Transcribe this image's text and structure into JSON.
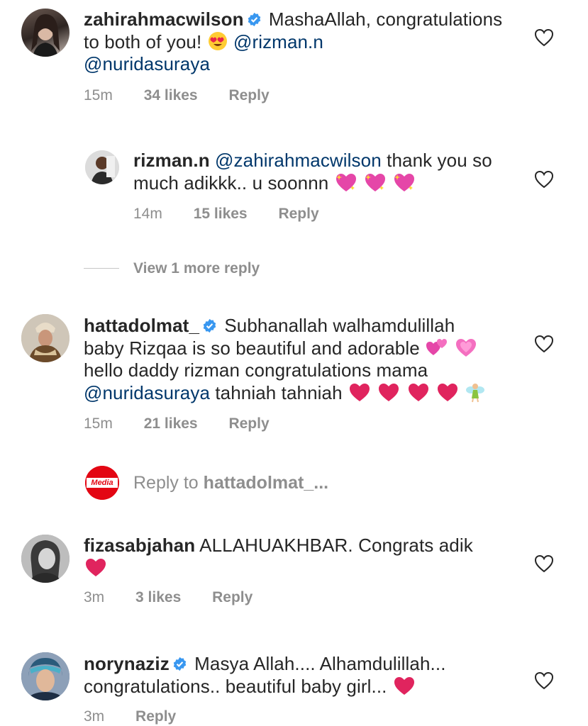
{
  "comments": [
    {
      "username": "zahirahmacwilson",
      "verified": true,
      "text_before": "MashaAllah, congratulations to both of you!",
      "emoji_1": "heart-eyes-emoji",
      "mention_1": "@rizman.n",
      "mention_2": "@nuridasuraya",
      "time": "15m",
      "likes": "34 likes",
      "reply_label": "Reply"
    },
    {
      "username": "rizman.n",
      "verified": false,
      "mention_1": "@zahirahmacwilson",
      "text_after": "thank you so much adikkk.. u soonnn",
      "emojis": [
        "sparkling-heart-emoji",
        "sparkling-heart-emoji",
        "sparkling-heart-emoji"
      ],
      "time": "14m",
      "likes": "15 likes",
      "reply_label": "Reply"
    },
    {
      "username": "hattadolmat_",
      "verified": true,
      "line1": "Subhanallah walhamdulillah",
      "line2": "baby Rizqaa is so beautiful and adorable",
      "line3": "hello daddy rizman congratulations mama",
      "mention_1": "@nuridasuraya",
      "line4_after": "tahniah tahniah",
      "time": "15m",
      "likes": "21 likes",
      "reply_label": "Reply"
    },
    {
      "username": "fizasabjahan",
      "verified": false,
      "text": "ALLAHUAKHBAR. Congrats adik",
      "time": "3m",
      "likes": "3 likes",
      "reply_label": "Reply"
    },
    {
      "username": "norynaziz",
      "verified": true,
      "line1": "Masya Allah.... Alhamdulillah...",
      "line2": "congratulations.. beautiful baby girl...",
      "time": "3m",
      "reply_label": "Reply"
    }
  ],
  "view_more": "View 1 more reply",
  "reply_to": {
    "prefix": "Reply to",
    "username": "hattadolmat_..."
  },
  "logo_text": "Media",
  "colors": {
    "text": "#262626",
    "meta": "#8e8e8e",
    "mention": "#00376b",
    "verified": "#3897f0",
    "heart_red": "#e0245e",
    "logo_red": "#e30613"
  }
}
